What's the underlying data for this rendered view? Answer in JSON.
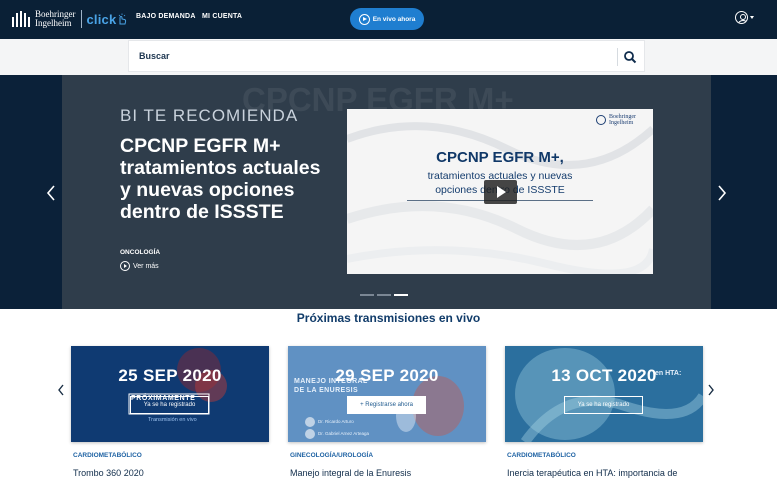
{
  "header": {
    "brand_name_line1": "Boehringer",
    "brand_name_line2": "Ingelheim",
    "brand_product": "click",
    "nav": [
      "BAJO DEMANDA",
      "MI CUENTA"
    ],
    "live_button": "En vivo ahora",
    "user_menu_icon": "user-icon"
  },
  "search": {
    "placeholder": "Buscar",
    "icon": "search-icon"
  },
  "hero": {
    "kicker": "BI TE RECOMIENDA",
    "title": "CPCNP EGFR M+ tratamientos actuales y nuevas opciones dentro de ISSSTE",
    "background_ghost": "CPCNP EGFR M+",
    "tag": "ONCOLOGÍA",
    "more_label": "Ver más",
    "video": {
      "logo_line1": "Boehringer",
      "logo_line2": "Ingelheim",
      "title": "CPCNP EGFR M+,",
      "subtitle_line1": "tratamientos actuales y nuevas",
      "subtitle_line2": "opciones dentro de ISSSTE"
    },
    "slides": 3,
    "active_slide": 3
  },
  "upcoming": {
    "title": "Próximas transmisiones en vivo",
    "cards": [
      {
        "date": "25 SEP 2020",
        "overlay_lines": [
          "PRÓXIMAMENTE",
          "Transmisión en vivo"
        ],
        "button": "Ya se ha registrado",
        "category": "CARDIOMETABÓLICO",
        "name": "Trombo 360 2020"
      },
      {
        "date": "29 SEP 2020",
        "overlay_lines": [
          "MANEJO INTEGRAL",
          "DE LA ENURESIS",
          "Dr. Ricardo Arturo",
          "Dr. Gabriel Arnez Arteaga"
        ],
        "button": "+ Registrarse ahora",
        "category": "GINECOLOGÍA/UROLOGÍA",
        "name": "Manejo integral de la Enuresis"
      },
      {
        "date": "13 OCT 2020",
        "overlay_lines": [
          "en HTA:"
        ],
        "button": "Ya se ha registrado",
        "category": "CARDIOMETABÓLICO",
        "name": "Inercia terapéutica en HTA: importancia de"
      }
    ]
  },
  "colors": {
    "header_bg": "#0a2036",
    "accent_blue": "#1f7ed0",
    "brand_light_blue": "#4aa3e6",
    "title_navy": "#113c6a",
    "category_blue": "#1e62a3"
  }
}
